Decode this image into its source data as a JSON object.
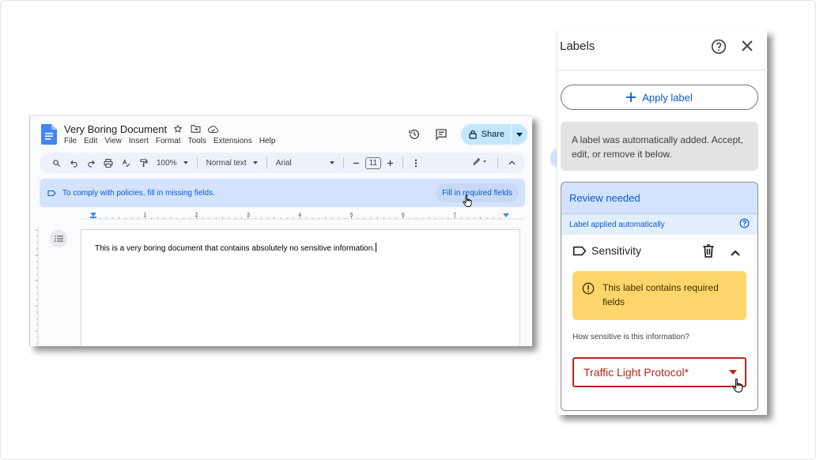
{
  "docs": {
    "title": "Very Boring Document",
    "menu": [
      "File",
      "Edit",
      "View",
      "Insert",
      "Format",
      "Tools",
      "Extensions",
      "Help"
    ],
    "share_label": "Share",
    "toolbar": {
      "zoom": "100%",
      "style": "Normal text",
      "font": "Arial",
      "font_size": "11"
    },
    "policy_banner": {
      "message": "To comply with policies, fill in missing fields.",
      "action": "Fill in required fields"
    },
    "ruler_numbers": [
      "1",
      "2",
      "3",
      "4",
      "5",
      "6",
      "7"
    ],
    "body_text": "This is a very boring document that contains absolutely no sensitive information."
  },
  "labels_panel": {
    "title": "Labels",
    "apply_label": "Apply label",
    "auto_note": "A label was automatically added. Accept, edit, or remove it below.",
    "review": {
      "header": "Review needed",
      "auto_applied": "Label applied automatically",
      "label_name": "Sensitivity",
      "warning": "This label contains required fields",
      "question": "How sensitive is this information?",
      "select_value": "Traffic Light Protocol*"
    }
  },
  "colors": {
    "accent_blue": "#0b57d0",
    "banner_blue": "#d3e3fd",
    "warning_yellow": "#fdd66b",
    "error_red": "#b3261e",
    "share_bg": "#c2e7ff"
  }
}
